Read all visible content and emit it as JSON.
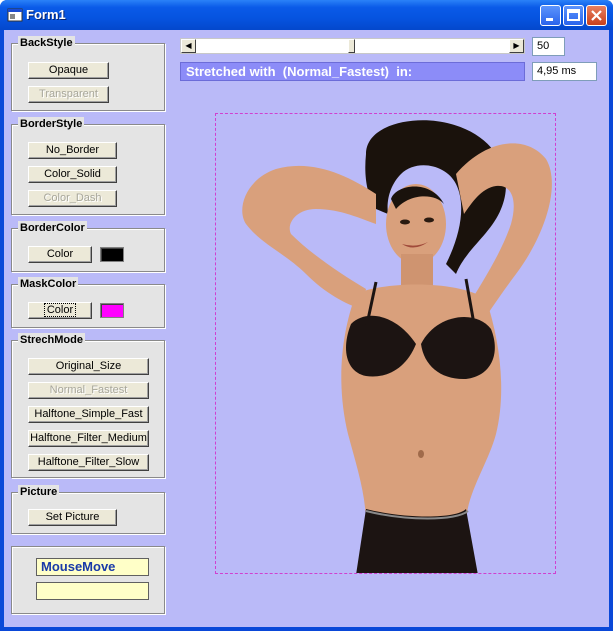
{
  "window": {
    "title": "Form1"
  },
  "title_buttons": {
    "minimize": "minimize",
    "maximize": "maximize",
    "close": "close"
  },
  "back_style": {
    "title": "BackStyle",
    "opaque": "Opaque",
    "transparent": "Transparent"
  },
  "border_style": {
    "title": "BorderStyle",
    "no_border": "No_Border",
    "solid": "Color_Solid",
    "dash": "Color_Dash"
  },
  "border_color": {
    "title": "BorderColor",
    "button": "Color",
    "swatch": "#000000"
  },
  "mask_color": {
    "title": "MaskColor",
    "button": "Color",
    "swatch": "#ff00ff"
  },
  "stretch_mode": {
    "title": "StrechMode",
    "original": "Original_Size",
    "normal_fastest": "Normal_Fastest",
    "halftone_simple": "Halftone_Simple_Fast",
    "halftone_medium": "Halftone_Filter_Medium",
    "halftone_slow": "Halftone_Filter_Slow"
  },
  "picture": {
    "title": "Picture",
    "set": "Set Picture"
  },
  "mouse_move": {
    "label": "MouseMove",
    "value": ""
  },
  "scroll": {
    "value": "50",
    "position": 0.5
  },
  "status": {
    "text": "Stretched with  (Normal_Fastest)  in:",
    "time": "4,95 ms"
  },
  "colors": {
    "client_bg": "#babaf8",
    "status_bg": "#8c8cf8",
    "mask_border": "#d040d0"
  }
}
